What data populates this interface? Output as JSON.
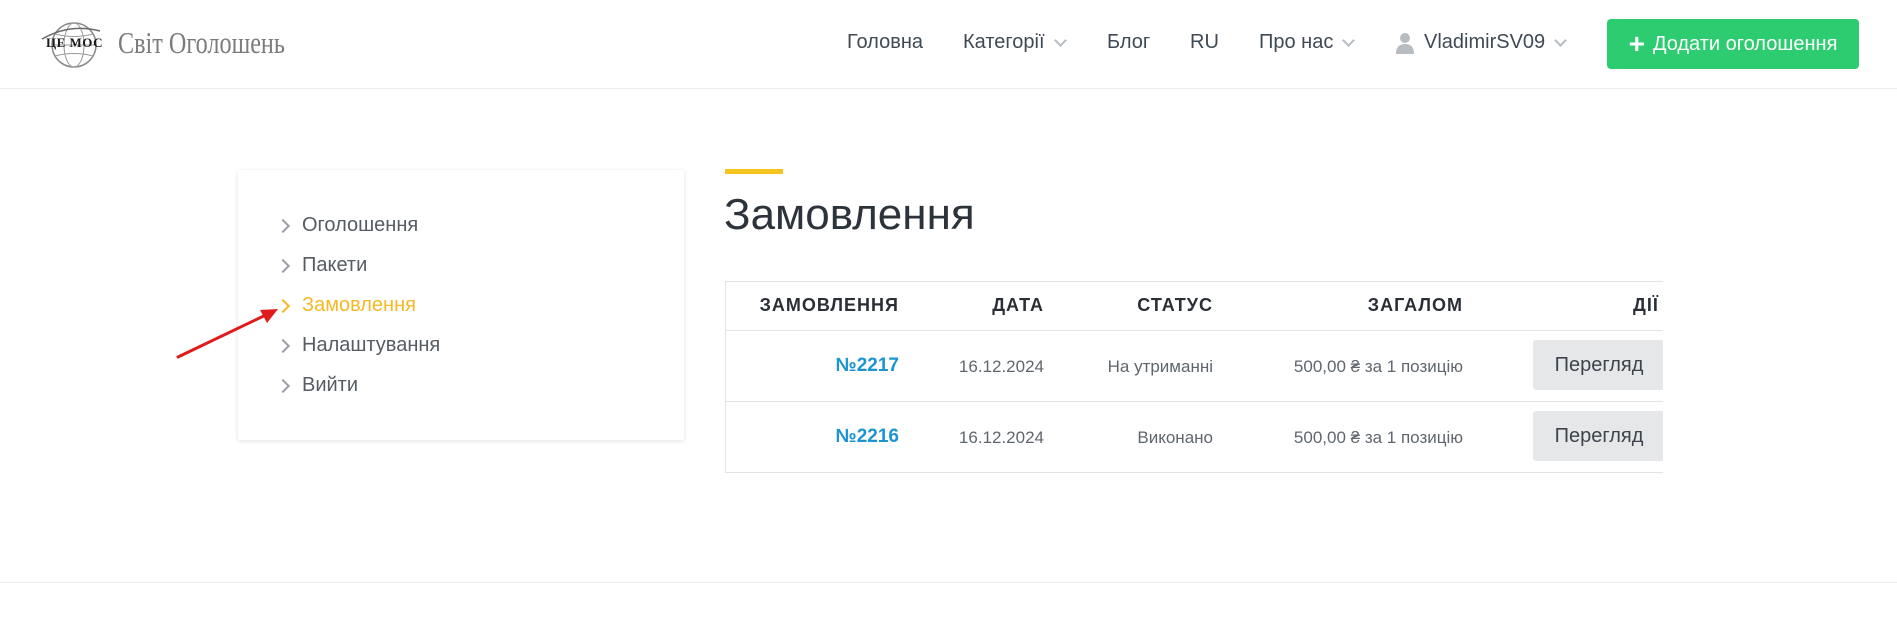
{
  "logo": {
    "mark": "ЦЕ МОС",
    "text": "Світ Оголошень"
  },
  "nav": {
    "home": "Головна",
    "categories": "Категорії",
    "blog": "Блог",
    "lang": "RU",
    "about": "Про нас",
    "user": "VladimirSV09",
    "add_button": "Додати оголошення"
  },
  "sidebar": {
    "items": [
      {
        "label": "Оголошення"
      },
      {
        "label": "Пакети"
      },
      {
        "label": "Замовлення"
      },
      {
        "label": "Налаштування"
      },
      {
        "label": "Вийти"
      }
    ]
  },
  "page": {
    "title": "Замовлення"
  },
  "table": {
    "headers": {
      "order": "ЗАМОВЛЕННЯ",
      "date": "ДАТА",
      "status": "СТАТУС",
      "total": "ЗАГАЛОМ",
      "actions": "ДІЇ"
    },
    "rows": [
      {
        "order": "№2217",
        "date": "16.12.2024",
        "status": "На утриманні",
        "total": "500,00 ₴ за 1 позицію",
        "action": "Перегляд"
      },
      {
        "order": "№2216",
        "date": "16.12.2024",
        "status": "Виконано",
        "total": "500,00 ₴ за 1 позицію",
        "action": "Перегляд"
      }
    ]
  },
  "colors": {
    "accent": "#f4b923",
    "primary_button": "#2ecc71",
    "link": "#1b94d2",
    "annotation_arrow": "#e11b1b"
  }
}
